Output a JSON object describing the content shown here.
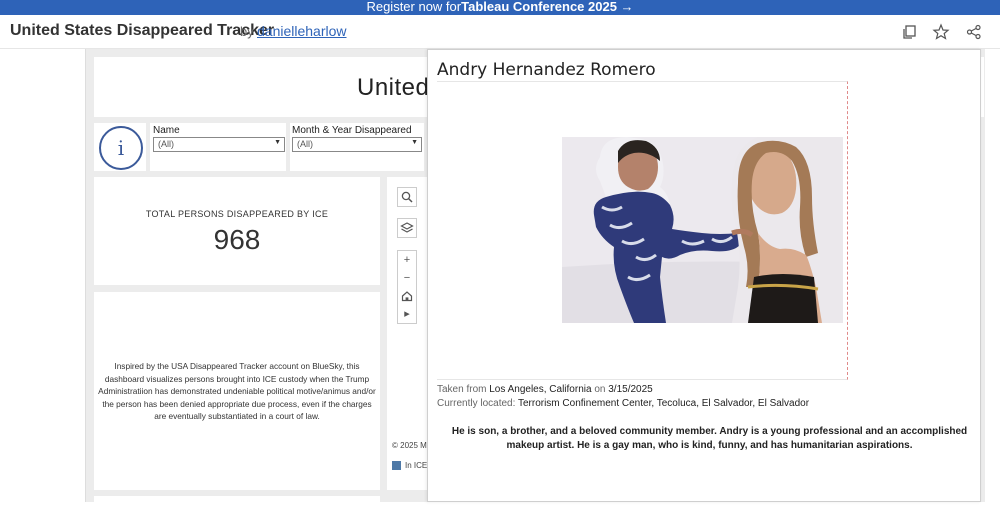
{
  "banner": {
    "prefix": "Register now for ",
    "link": "Tableau Conference 2025 →"
  },
  "header": {
    "title": "United States Disappeared Tracker",
    "by": "by",
    "author": "danielleharlow",
    "icons": [
      "copy-icon",
      "star-icon",
      "share-icon"
    ]
  },
  "dashboard": {
    "title": "United",
    "info_glyph": "i",
    "filters": [
      {
        "label": "Name",
        "value": "(All)"
      },
      {
        "label": "Month & Year Disappeared",
        "value": "(All)"
      }
    ],
    "kpi": {
      "label": "TOTAL PERSONS DISAPPEARED BY ICE",
      "value": "968"
    },
    "description": "Inspired by the USA Disappeared Tracker account on BlueSky, this dashboard visualizes persons brought into ICE custody when the Trump Administratiion has demonstrated undeniable political motive/animus and/or the person has been denied appropriate due process, even if the charges are eventually substantiated in a court of law.",
    "map_tools": [
      "search",
      "layers",
      "+",
      "−",
      "home",
      "▸"
    ],
    "copyright": "© 2025 M",
    "legend": "In ICE",
    "legend_color": "#4e79a7"
  },
  "tooltip": {
    "name": "Andry Hernandez Romero",
    "taken_prefix": "Taken from ",
    "taken_place": "Los Angeles, California",
    "taken_on": " on ",
    "taken_date": "3/15/2025",
    "located_prefix": "Currently located: ",
    "located_place": "Terrorism Confinement Center, Tecoluca, El Salvador, El Salvador",
    "bio": "He is son, a brother, and a beloved community member. Andry is a young professional and an accomplished makeup artist. He is a gay man, who is kind, funny, and has humanitarian aspirations."
  }
}
